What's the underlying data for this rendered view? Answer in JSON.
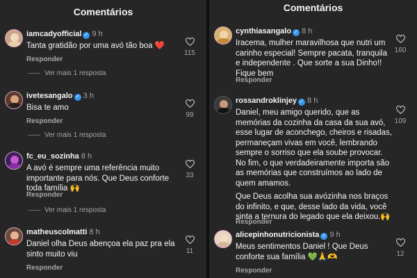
{
  "left": {
    "title": "Comentários",
    "comments": [
      {
        "username": "iamcadyofficial",
        "time": "9 h",
        "text": "Tanta gratidão por uma avó tão boa ❤️",
        "reply": "Responder",
        "likes": "115",
        "more": "Ver mais 1 resposta"
      },
      {
        "username": "ivetesangalo",
        "time": "3 h",
        "text": "Bisa te amo",
        "reply": "Responder",
        "likes": "99",
        "more": "Ver mais 1 resposta"
      },
      {
        "username": "fc_eu_sozinha",
        "time": "8 h",
        "text_lines": [
          "A avó é sempre uma referência muito",
          "importante para nós. Que Deus conforte",
          "toda família 🙌"
        ],
        "reply": "Responder",
        "likes": "33",
        "more": "Ver mais 1 resposta"
      },
      {
        "username": "matheuscolmatti",
        "time": "8 h",
        "text_lines": [
          "Daniel olha Deus abençoa ela paz pra ela",
          "sinto muito viu"
        ],
        "reply": "Responder",
        "likes": "11"
      }
    ]
  },
  "right": {
    "title": "Comentários",
    "comments": [
      {
        "username": "cynthiasangalo",
        "time": "8 h",
        "text_lines": [
          "Iracema, mulher maravilhosa  que nutri um",
          "carinho especial! Sempre pacata, tranquila",
          "e independente . Que sorte a sua Dinho!!",
          "Fique bem"
        ],
        "reply": "Responder",
        "likes": "160"
      },
      {
        "username": "rossandroklinjey",
        "time": "8 h",
        "text_lines": [
          "Daniel, meu amigo querido, que as",
          "memórias da cozinha da casa da sua avó,",
          "esse lugar de aconchego, cheiros e risadas,",
          "permaneçam vivas em você, lembrando",
          "sempre o sorriso que ela soube provocar.",
          "No fim, o que verdadeiramente importa são",
          "as memórias que construímos ao lado de",
          "quem amamos.",
          "",
          "Que Deus acolha sua avózinha nos braços",
          "do infinito, e que, desse lado da vida, você",
          "sinta a ternura do legado que ela deixou.🙌"
        ],
        "reply": "Responder",
        "likes": "109"
      },
      {
        "username": "alicepinhonutricionista",
        "time": "9 h",
        "text_lines": [
          "Meus sentimentos Daniel ! Que Deus",
          "conforte sua família 💚🙏🫶"
        ],
        "reply": "Responder",
        "likes": "12"
      }
    ]
  }
}
